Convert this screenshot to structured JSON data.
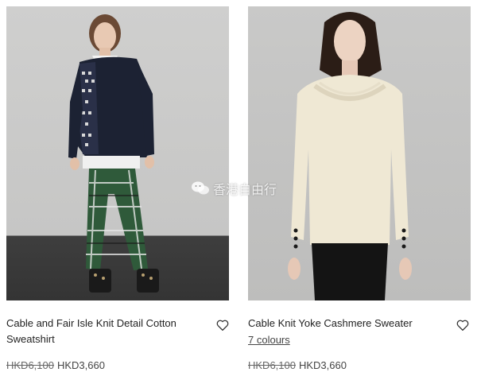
{
  "products": [
    {
      "name": "Cable and Fair Isle Knit Detail Cotton Sweatshirt",
      "colours": "",
      "old_price": "HKD6,100",
      "new_price": "HKD3,660",
      "icon": "heart-outline-icon"
    },
    {
      "name": "Cable Knit Yoke Cashmere Sweater",
      "colours": "7 colours",
      "old_price": "HKD6,100",
      "new_price": "HKD3,660",
      "icon": "heart-outline-icon"
    }
  ],
  "watermark": {
    "text": "香港自由行",
    "icon": "wechat-icon"
  },
  "colors": {
    "text": "#222222",
    "backdrop": "#c8c8c7",
    "floor": "#3a3a3a"
  }
}
